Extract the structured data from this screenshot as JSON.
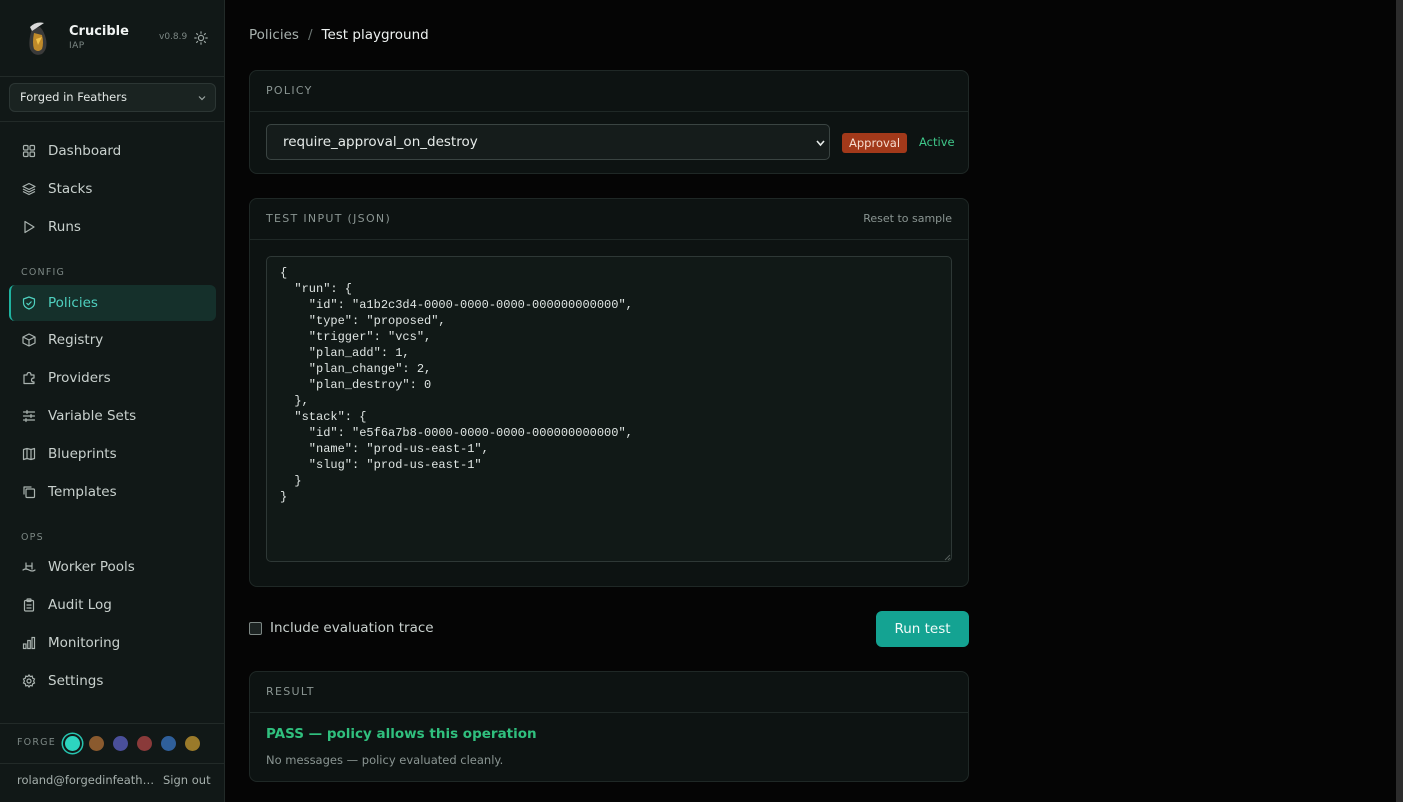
{
  "brand": {
    "name": "Crucible",
    "sub": "IAP",
    "version": "v0.8.9"
  },
  "org_selector": {
    "value": "Forged in Feathers"
  },
  "nav": {
    "main": [
      {
        "label": "Dashboard",
        "icon": "grid-icon"
      },
      {
        "label": "Stacks",
        "icon": "layers-icon"
      },
      {
        "label": "Runs",
        "icon": "play-icon"
      }
    ],
    "config_label": "CONFIG",
    "config": [
      {
        "label": "Policies",
        "icon": "shield-icon",
        "active": true
      },
      {
        "label": "Registry",
        "icon": "package-icon"
      },
      {
        "label": "Providers",
        "icon": "puzzle-icon"
      },
      {
        "label": "Variable Sets",
        "icon": "sliders-icon"
      },
      {
        "label": "Blueprints",
        "icon": "map-icon"
      },
      {
        "label": "Templates",
        "icon": "copy-icon"
      }
    ],
    "ops_label": "OPS",
    "ops": [
      {
        "label": "Worker Pools",
        "icon": "pool-icon"
      },
      {
        "label": "Audit Log",
        "icon": "clipboard-icon"
      },
      {
        "label": "Monitoring",
        "icon": "bar-chart-icon"
      },
      {
        "label": "Settings",
        "icon": "gear-icon"
      }
    ]
  },
  "forge": {
    "label": "FORGE",
    "swatches": [
      "#2dd4bf",
      "#8a5a2e",
      "#4a4f9a",
      "#8a3a3a",
      "#2f5f9a",
      "#9a7a2a"
    ],
    "selected_index": 0
  },
  "user": {
    "email": "roland@forgedinfeathers.com",
    "signout": "Sign out"
  },
  "breadcrumb": {
    "parent": "Policies",
    "separator": "/",
    "current": "Test playground"
  },
  "policy_card": {
    "title": "POLICY",
    "selected_policy": "require_approval_on_destroy",
    "type_badge": "Approval",
    "status": "Active"
  },
  "input_card": {
    "title": "TEST INPUT (JSON)",
    "reset_label": "Reset to sample",
    "json": "{\n  \"run\": {\n    \"id\": \"a1b2c3d4-0000-0000-0000-000000000000\",\n    \"type\": \"proposed\",\n    \"trigger\": \"vcs\",\n    \"plan_add\": 1,\n    \"plan_change\": 2,\n    \"plan_destroy\": 0\n  },\n  \"stack\": {\n    \"id\": \"e5f6a7b8-0000-0000-0000-000000000000\",\n    \"name\": \"prod-us-east-1\",\n    \"slug\": \"prod-us-east-1\"\n  }\n}"
  },
  "trace_checkbox": {
    "label": "Include evaluation trace",
    "checked": false
  },
  "run_button": {
    "label": "Run test"
  },
  "result_card": {
    "title": "RESULT",
    "status": "PASS — policy allows this operation",
    "message": "No messages — policy evaluated cleanly."
  }
}
